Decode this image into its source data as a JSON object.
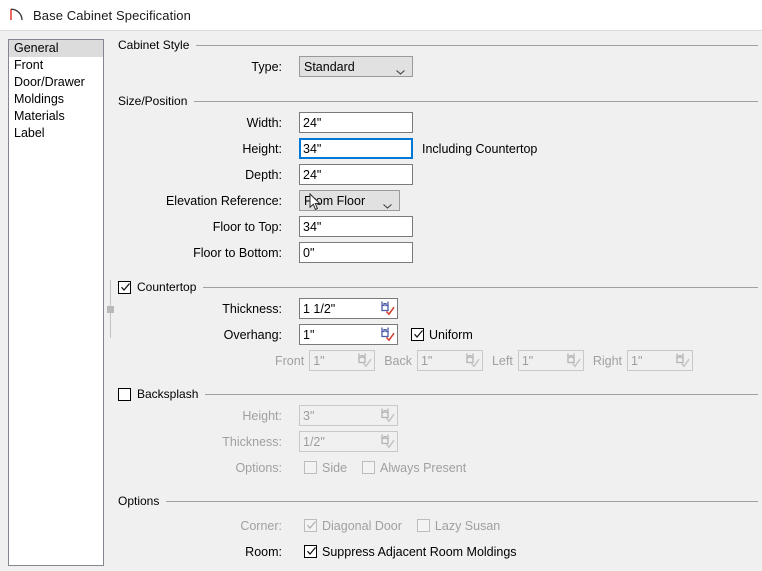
{
  "window": {
    "title": "Base Cabinet Specification",
    "icon": "cabinet-arc-icon"
  },
  "sidebar": {
    "items": [
      {
        "label": "General",
        "selected": true
      },
      {
        "label": "Front",
        "selected": false
      },
      {
        "label": "Door/Drawer",
        "selected": false
      },
      {
        "label": "Moldings",
        "selected": false
      },
      {
        "label": "Materials",
        "selected": false
      },
      {
        "label": "Label",
        "selected": false
      }
    ]
  },
  "groups": {
    "cabinet_style": {
      "title": "Cabinet Style",
      "type_label": "Type:",
      "type_value": "Standard"
    },
    "size_position": {
      "title": "Size/Position",
      "width_label": "Width:",
      "width_value": "24\"",
      "height_label": "Height:",
      "height_value": "34\"",
      "height_note": "Including Countertop",
      "depth_label": "Depth:",
      "depth_value": "24\"",
      "elevation_label": "Elevation Reference:",
      "elevation_value": "From Floor",
      "floor_to_top_label": "Floor to Top:",
      "floor_to_top_value": "34\"",
      "floor_to_bottom_label": "Floor to Bottom:",
      "floor_to_bottom_value": "0\""
    },
    "countertop": {
      "title": "Countertop",
      "checked": true,
      "thickness_label": "Thickness:",
      "thickness_value": "1 1/2\"",
      "overhang_label": "Overhang:",
      "overhang_value": "1\"",
      "uniform_label": "Uniform",
      "uniform_checked": true,
      "front_label": "Front",
      "front_value": "1\"",
      "back_label": "Back",
      "back_value": "1\"",
      "left_label": "Left",
      "left_value": "1\"",
      "right_label": "Right",
      "right_value": "1\""
    },
    "backsplash": {
      "title": "Backsplash",
      "checked": false,
      "height_label": "Height:",
      "height_value": "3\"",
      "thickness_label": "Thickness:",
      "thickness_value": "1/2\"",
      "options_label": "Options:",
      "side_label": "Side",
      "side_checked": false,
      "always_present_label": "Always Present",
      "always_present_checked": false
    },
    "options": {
      "title": "Options",
      "corner_label": "Corner:",
      "diagonal_door_label": "Diagonal Door",
      "diagonal_door_checked": true,
      "lazy_susan_label": "Lazy Susan",
      "lazy_susan_checked": false,
      "room_label": "Room:",
      "suppress_label": "Suppress Adjacent Room Moldings",
      "suppress_checked": true
    }
  },
  "colors": {
    "window_bg": "#f0f0f0",
    "focus_border": "#0078d7",
    "dyn_icon_blue": "#4b5aa7",
    "dyn_icon_red": "#d03a28",
    "selected_row": "#dcdcdc"
  }
}
